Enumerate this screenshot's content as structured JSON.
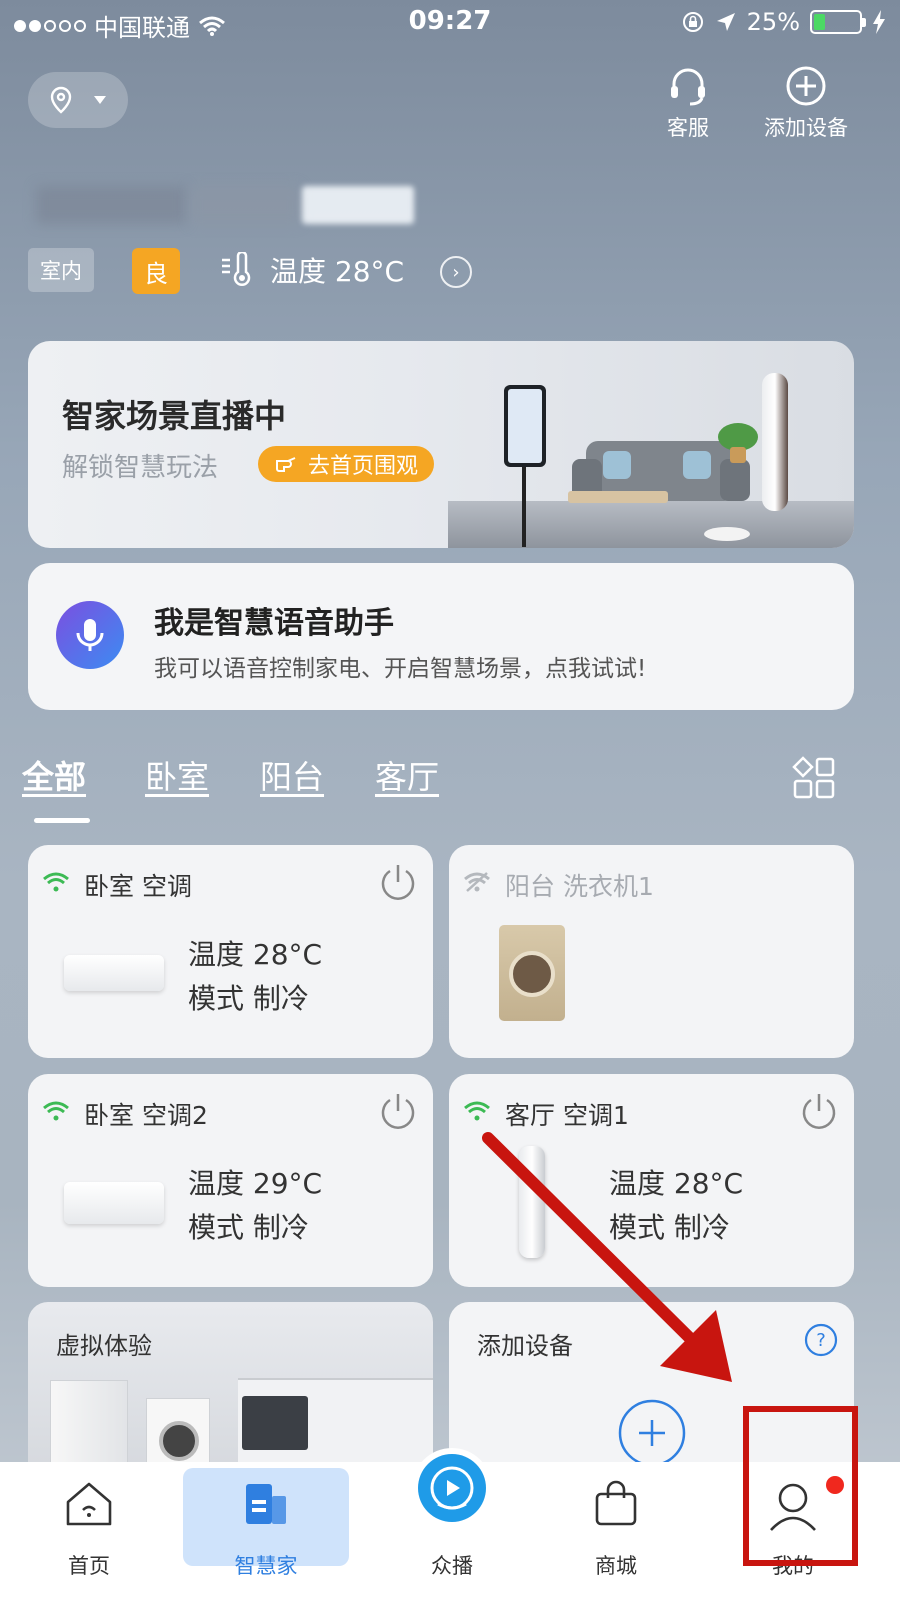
{
  "status_bar": {
    "carrier": "中国联通",
    "time": "09:27",
    "battery": "25%",
    "battery_level": 0.25
  },
  "header": {
    "service_label": "客服",
    "add_device_label": "添加设备"
  },
  "environment": {
    "indoor_label": "室内",
    "air_quality": "良",
    "temperature": "温度 28°C",
    "accent_color": "#f5a623"
  },
  "banner": {
    "title": "智家场景直播中",
    "subtitle": "解锁智慧玩法",
    "button": "去首页围观"
  },
  "voice_assistant": {
    "title": "我是智慧语音助手",
    "subtitle": "我可以语音控制家电、开启智慧场景，点我试试!"
  },
  "room_tabs": {
    "items": [
      "全部",
      "卧室",
      "阳台",
      "客厅"
    ],
    "active": "全部"
  },
  "devices": [
    {
      "name": "卧室 空调",
      "online": true,
      "line1": "温度 28°C",
      "line2": "模式 制冷",
      "icon": "wall-ac"
    },
    {
      "name": "阳台 洗衣机1",
      "online": false,
      "icon": "washing-machine"
    },
    {
      "name": "卧室 空调2",
      "online": true,
      "line1": "温度 29°C",
      "line2": "模式 制冷",
      "icon": "wall-ac"
    },
    {
      "name": "客厅 空调1",
      "online": true,
      "line1": "温度 28°C",
      "line2": "模式 制冷",
      "icon": "floor-ac"
    }
  ],
  "virtual_experience": {
    "title": "虚拟体验"
  },
  "add_device_card": {
    "title": "添加设备"
  },
  "bottom_nav": {
    "home": "首页",
    "smart_home": "智慧家",
    "broadcast": "众播",
    "mall": "商城",
    "mine": "我的",
    "active": "智慧家",
    "active_color": "#2f7fe0"
  },
  "annotation": {
    "color": "#c8150f"
  }
}
